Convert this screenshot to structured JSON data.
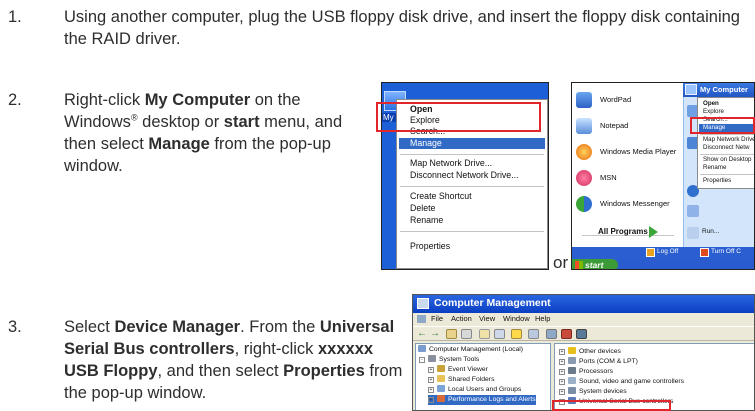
{
  "steps": [
    {
      "number": "1.",
      "text": "Using another computer, plug the USB floppy disk drive, and insert the floppy disk containing the RAID driver."
    },
    {
      "number": "2.",
      "t1": "Right-click ",
      "b1": "My Computer",
      "t2": " on the Windows",
      "sup": "®",
      "t3": " desktop or ",
      "b2": "start",
      "t4": " menu, and then select ",
      "b3": "Manage",
      "t5": " from the pop-up window."
    },
    {
      "number": "3.",
      "t1": "Select ",
      "b1": "Device Manager",
      "t2": ". From the ",
      "b2": "Universal Serial Bus controllers",
      "t3": ", right-click ",
      "b3": "xxxxxx USB Floppy",
      "t4": ", and then select ",
      "b4": "Properties",
      "t5": " from the pop-up window."
    }
  ],
  "or_label": "or",
  "context_menu": {
    "desktop_label": "My C",
    "items": [
      "Open",
      "Explore",
      "Search...",
      "Manage",
      "Map Network Drive...",
      "Disconnect Network Drive...",
      "Create Shortcut",
      "Delete",
      "Rename",
      "Properties"
    ],
    "highlighted": "Manage"
  },
  "start_menu": {
    "programs": [
      "WordPad",
      "Notepad",
      "Windows Media Player",
      "MSN",
      "Windows Messenger"
    ],
    "all_programs": "All Programs",
    "header": "My Computer",
    "submenu": [
      "Open",
      "Explore",
      "Search...",
      "Manage",
      "Map Network Drive...",
      "Disconnect Netw",
      "Show on Desktop",
      "Rename",
      "Properties"
    ],
    "right_extra": "Run...",
    "log_off": "Log Off",
    "turn_off": "Turn Off C",
    "start": "start"
  },
  "computer_management": {
    "title": "Computer Management",
    "menus": [
      "File",
      "Action",
      "View",
      "Window",
      "Help"
    ],
    "left_tree": [
      "Computer Management (Local)",
      "System Tools",
      "Event Viewer",
      "Shared Folders",
      "Local Users and Groups",
      "Performance Logs and Alerts"
    ],
    "right_tree": [
      "Other devices",
      "Ports (COM & LPT)",
      "Processors",
      "Sound, video and game controllers",
      "System devices",
      "Universal Serial Bus controllers"
    ]
  },
  "colors": {
    "highlight_box": "#e0262b",
    "xp_blue": "#2b5fd1",
    "menu_selection": "#316ac5"
  }
}
